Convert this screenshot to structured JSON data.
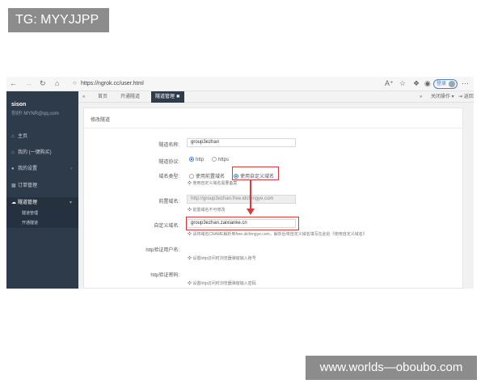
{
  "watermarks": {
    "top_left": "TG: MYYJJPP",
    "bottom_right": "www.worlds—oboubo.com"
  },
  "browser": {
    "url": "https://ngrok.cc/user.html",
    "login_label": "登录",
    "icons": [
      "back-icon",
      "forward-icon",
      "reload-icon",
      "home-icon",
      "lock-icon",
      "read-aloud-icon",
      "favorite-icon",
      "collections-icon",
      "extensions-icon",
      "more-icon"
    ]
  },
  "sidebar": {
    "user_name": "sison",
    "user_mail": "你好! MYNR@qq.com",
    "items": [
      {
        "label": "主页",
        "icon": "home-icon"
      },
      {
        "label": "我的 (一键购买)",
        "icon": "home-icon"
      },
      {
        "label": "我的设置",
        "icon": "user-icon"
      },
      {
        "label": "订单管理",
        "icon": "cart-icon"
      },
      {
        "label": "隧道管理",
        "icon": "cloud-icon"
      }
    ],
    "sub_items": [
      "隧道管理",
      "开通隧道"
    ]
  },
  "tabs": {
    "home": "首页",
    "open": "开通隧道",
    "active": "隧道管理",
    "close_ops": "关闭操作",
    "back": "返回"
  },
  "form": {
    "title": "修改隧道",
    "name_label": "隧道名称:",
    "name_value": "group3ezhan",
    "protocol_label": "隧道协议:",
    "protocol_http": "http",
    "protocol_https": "https",
    "domain_type_label": "域名类型:",
    "domain_type_opt1": "使用前置域名",
    "domain_type_opt2": "使用自定义域名",
    "domain_type_help": "使用自定义域名需要备案",
    "prefix_label": "前置域名:",
    "prefix_value": "http://group3ezhan.free.idcfengye.com",
    "prefix_help": "前置域名不可修改",
    "custom_label": "自定义域名:",
    "custom_value": "group3ezhan.zaixianke.cn",
    "custom_help": "请将域名CNAME解析到free.idcfengye.com，解析后将自定义域名填写在此处《使用自定义域名》",
    "auth_user_label": "http验证用户名:",
    "auth_user_help": "设置http访问时浏览器弹窗输入账号",
    "auth_pass_label": "http验证密码:",
    "auth_pass_help": "设置http访问时浏览器弹窗输入密码"
  },
  "annotation_color": "#d83b3b",
  "sidebar_color": "#2e3b4b"
}
